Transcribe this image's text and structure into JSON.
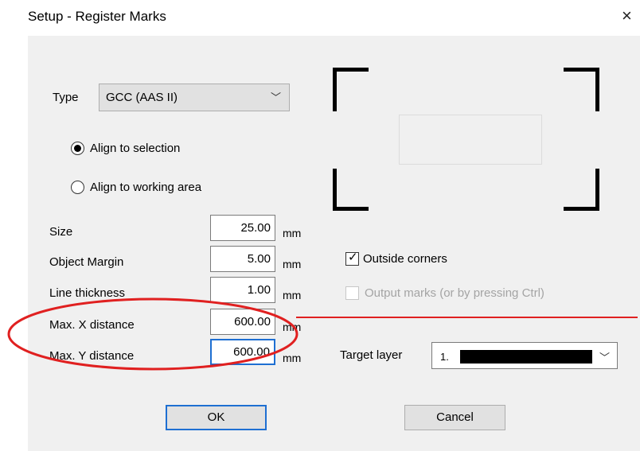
{
  "window": {
    "title": "Setup - Register Marks"
  },
  "icons": {
    "close": "×",
    "chevron": "﹀"
  },
  "type": {
    "label": "Type",
    "value": "GCC (AAS II)"
  },
  "alignment": [
    {
      "label": "Align to selection",
      "selected": true
    },
    {
      "label": "Align to working area",
      "selected": false
    }
  ],
  "fields": [
    {
      "label": "Size",
      "value": "25.00",
      "unit": "mm"
    },
    {
      "label": "Object Margin",
      "value": "5.00",
      "unit": "mm"
    },
    {
      "label": "Line thickness",
      "value": "1.00",
      "unit": "mm"
    },
    {
      "label": "Max. X distance",
      "value": "600.00",
      "unit": "mm"
    },
    {
      "label": "Max. Y distance",
      "value": "600.00",
      "unit": "mm"
    }
  ],
  "options": {
    "outside_corners": {
      "label": "Outside corners",
      "checked": true
    },
    "output_marks": {
      "label": "Output marks (or by pressing Ctrl)",
      "checked": false,
      "enabled": false
    }
  },
  "target_layer": {
    "label": "Target layer",
    "value": "1."
  },
  "buttons": {
    "ok": "OK",
    "cancel": "Cancel"
  },
  "colors": {
    "annotation": "#e02020",
    "focus": "#1e6fd2",
    "dialog_bg": "#f0f0f0"
  }
}
